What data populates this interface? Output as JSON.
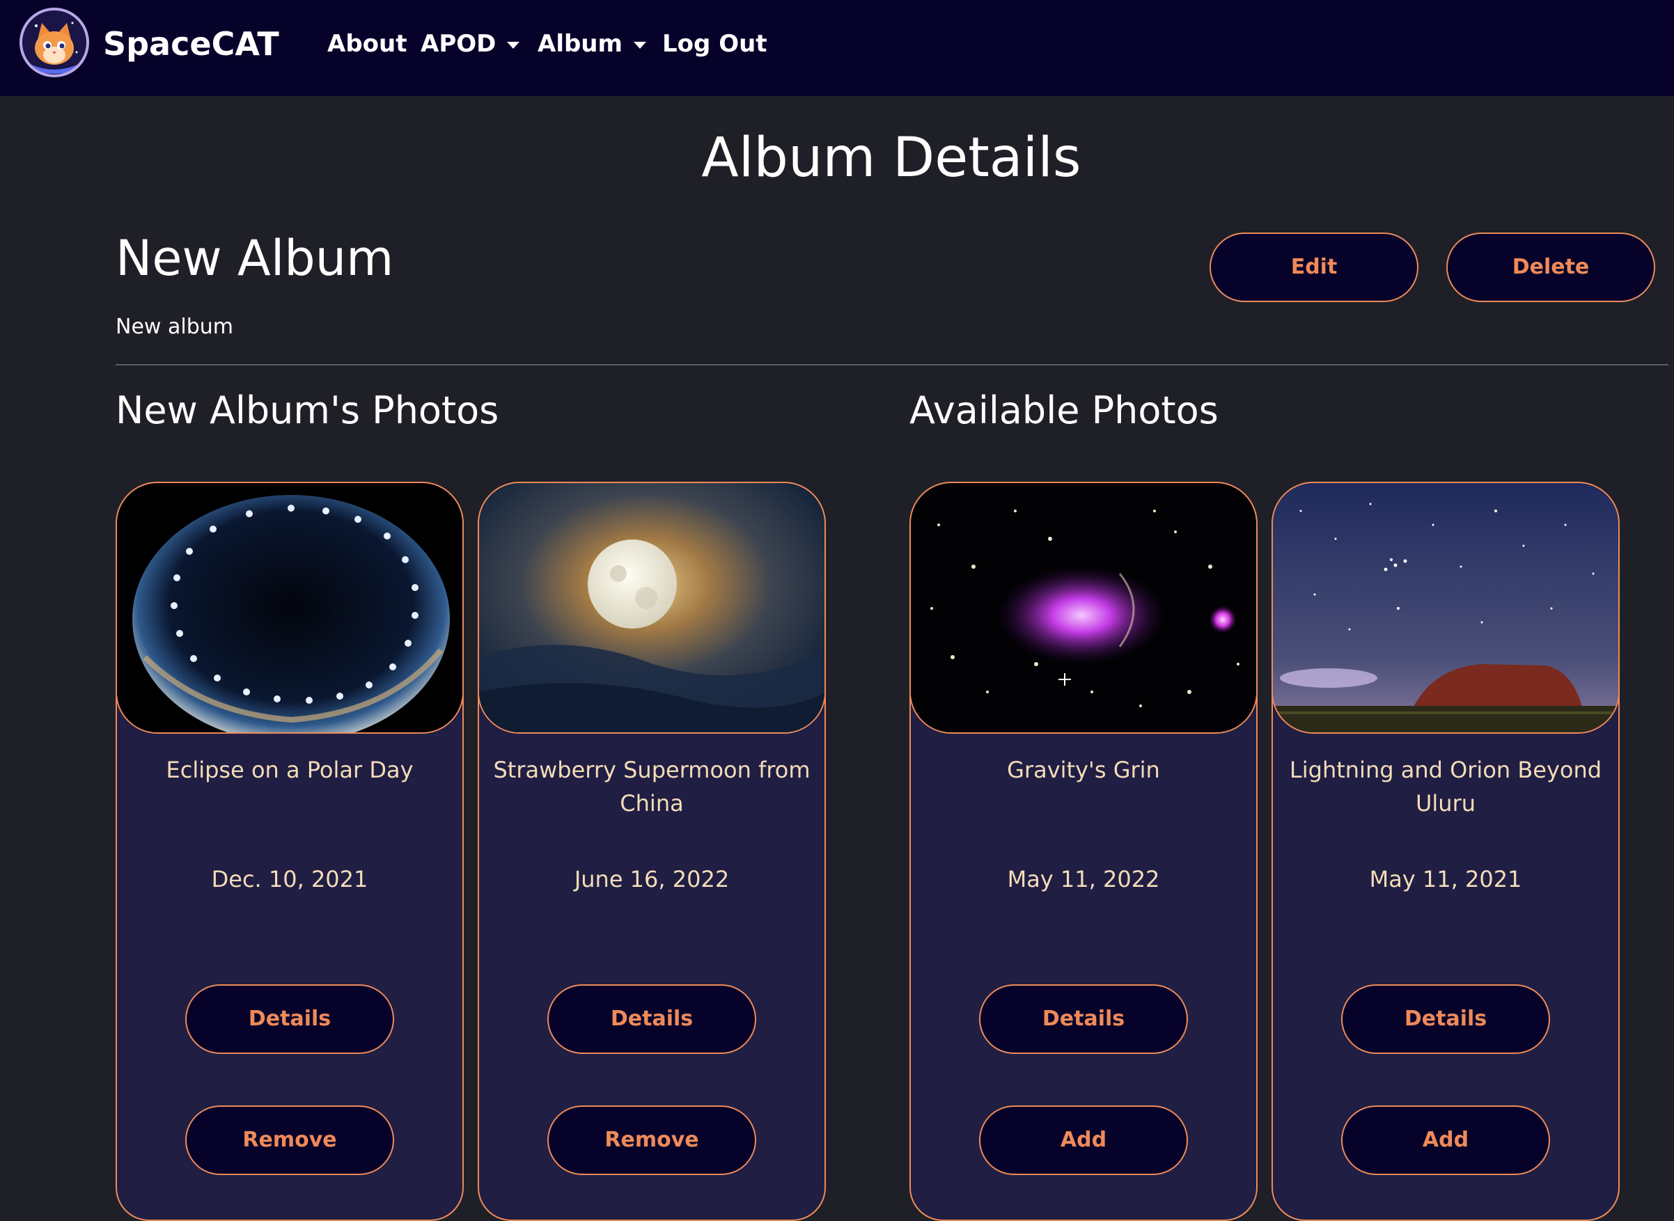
{
  "nav": {
    "brand": "SpaceCAT",
    "about": "About",
    "apod": "APOD",
    "album": "Album",
    "logout": "Log Out"
  },
  "page": {
    "title": "Album Details"
  },
  "album": {
    "name": "New Album",
    "description": "New album",
    "edit_label": "Edit",
    "delete_label": "Delete"
  },
  "sections": {
    "album_photos_title": "New Album's Photos",
    "available_photos_title": "Available Photos"
  },
  "album_photos": [
    {
      "title": "Eclipse on a Polar Day",
      "date": "Dec. 10, 2021",
      "details_label": "Details",
      "action_label": "Remove"
    },
    {
      "title": "Strawberry Supermoon from China",
      "date": "June 16, 2022",
      "details_label": "Details",
      "action_label": "Remove"
    }
  ],
  "available_photos": [
    {
      "title": "Gravity's Grin",
      "date": "May 11, 2022",
      "details_label": "Details",
      "action_label": "Add"
    },
    {
      "title": "Lightning and Orion Beyond Uluru",
      "date": "May 11, 2021",
      "details_label": "Details",
      "action_label": "Add"
    }
  ],
  "colors": {
    "navbar_bg": "#07022a",
    "page_bg": "#1f2027",
    "card_bg": "#201e43",
    "accent": "#ee8a59",
    "card_text": "#f4dcb8"
  },
  "icons": {
    "logo": "cat-astronaut-logo-icon",
    "dropdown": "caret-down-icon"
  }
}
